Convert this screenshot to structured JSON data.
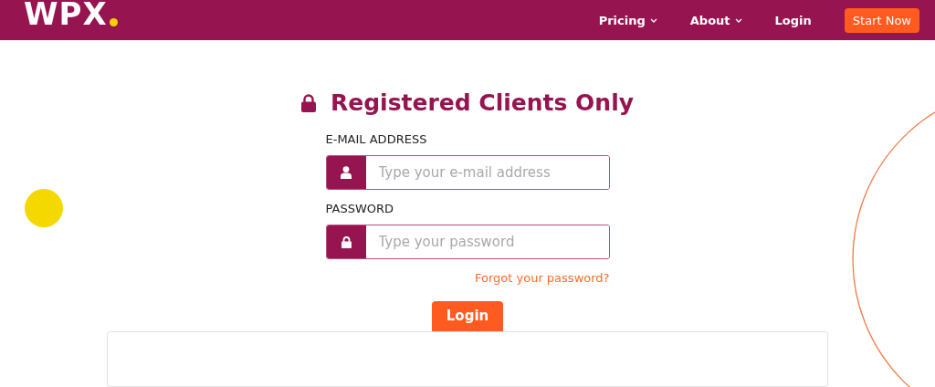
{
  "header": {
    "logo": "WPX",
    "nav": [
      {
        "label": "Pricing",
        "dropdown": true
      },
      {
        "label": "About",
        "dropdown": true
      },
      {
        "label": "Login",
        "dropdown": false
      }
    ],
    "cta": "Start Now"
  },
  "form": {
    "title": "Registered Clients Only",
    "fields": [
      {
        "label": "E-MAIL ADDRESS",
        "placeholder": "Type your e-mail address",
        "kind": "user"
      },
      {
        "label": "PASSWORD",
        "placeholder": "Type your password",
        "kind": "lock"
      }
    ],
    "forgot_link": "Forgot your password?",
    "submit": "Login"
  }
}
